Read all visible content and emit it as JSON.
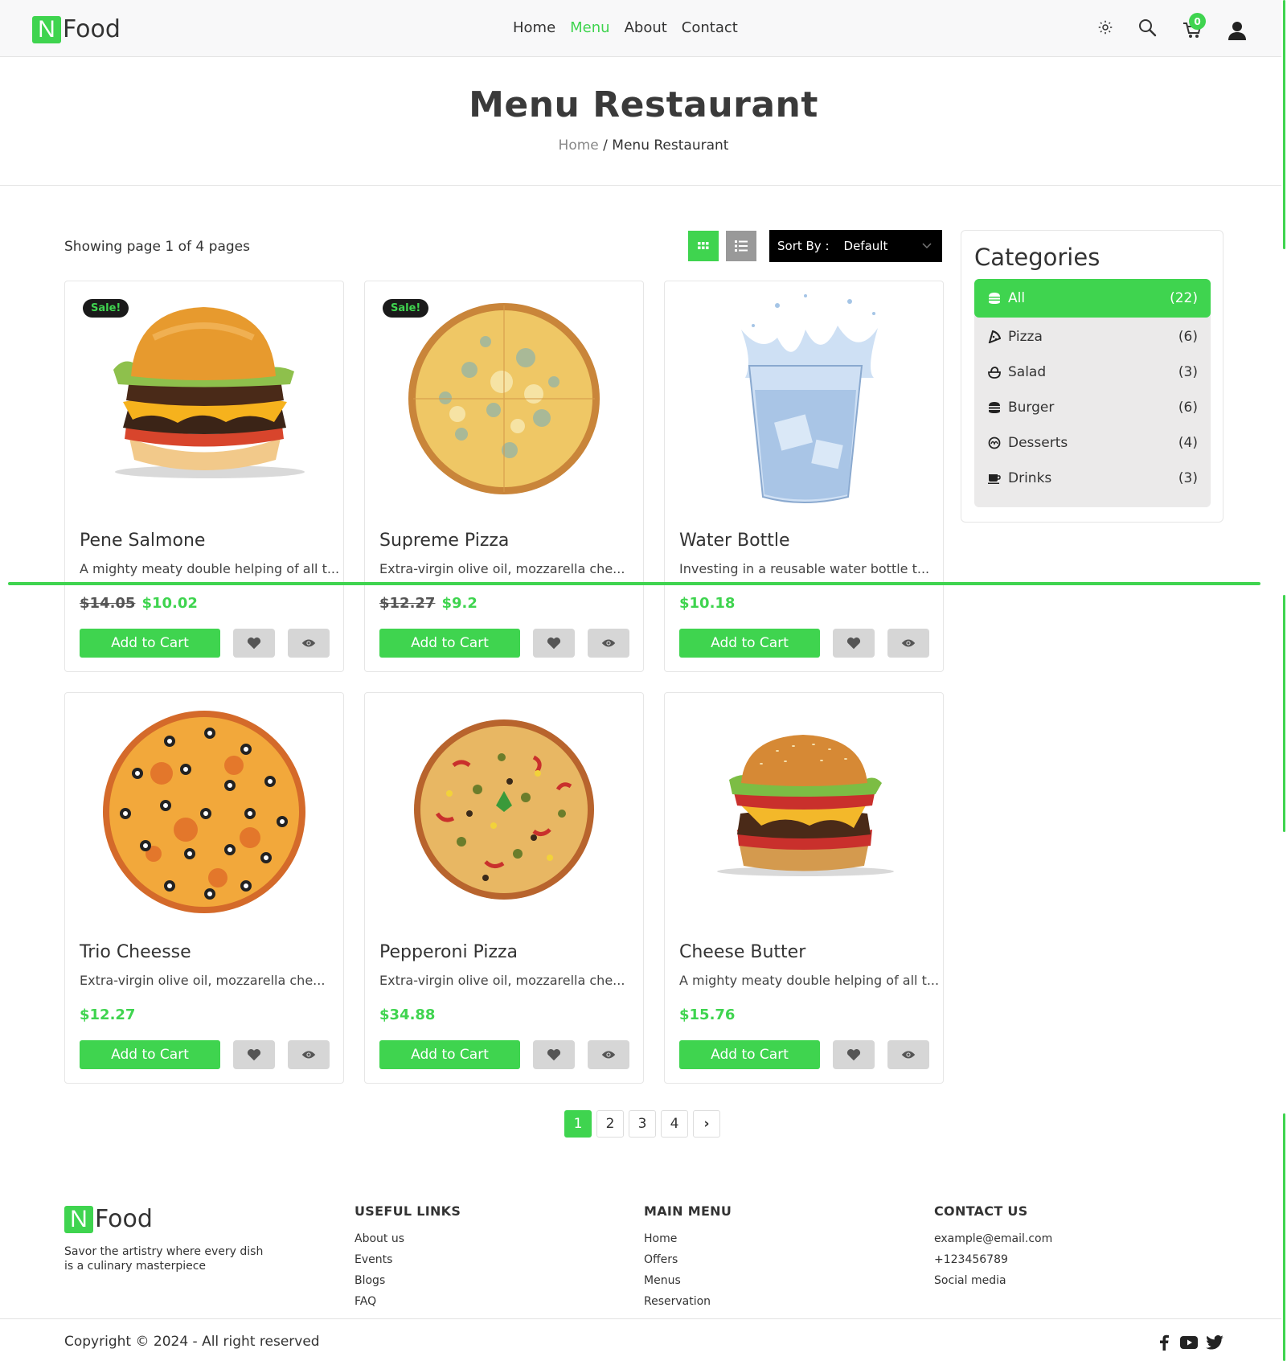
{
  "header": {
    "logo_letter": "N",
    "logo_text": "Food",
    "nav": [
      "Home",
      "Menu",
      "About",
      "Contact"
    ],
    "active_nav": "Menu",
    "cart_count": "0",
    "icons": [
      "sun-icon",
      "search-icon",
      "cart-icon",
      "user-icon"
    ]
  },
  "page": {
    "title": "Menu Restaurant",
    "breadcrumb_home": "Home",
    "breadcrumb_sep": " / ",
    "breadcrumb_current": "Menu Restaurant"
  },
  "toolbar": {
    "showing": "Showing page 1 of 4 pages",
    "sort_label": "Sort By :",
    "sort_value": "Default"
  },
  "products": [
    {
      "name": "Pene Salmone",
      "desc": "A mighty meaty double helping of all t...",
      "old_price": "$14.05",
      "price": "$10.02",
      "sale": "Sale!",
      "image": "burger"
    },
    {
      "name": "Supreme Pizza",
      "desc": "Extra-virgin olive oil, mozzarella che...",
      "old_price": "$12.27",
      "price": "$9.2",
      "sale": "Sale!",
      "image": "pizza-cheese"
    },
    {
      "name": "Water Bottle",
      "desc": "Investing in a reusable water bottle t...",
      "old_price": "",
      "price": "$10.18",
      "sale": "",
      "image": "water-glass"
    },
    {
      "name": "Trio Cheesse",
      "desc": "Extra-virgin olive oil, mozzarella che...",
      "old_price": "",
      "price": "$12.27",
      "sale": "",
      "image": "pizza-olive"
    },
    {
      "name": "Pepperoni Pizza",
      "desc": "Extra-virgin olive oil, mozzarella che...",
      "old_price": "",
      "price": "$34.88",
      "sale": "",
      "image": "pizza-pepperoni"
    },
    {
      "name": "Cheese Butter",
      "desc": "A mighty meaty double helping of all t...",
      "old_price": "",
      "price": "$15.76",
      "sale": "",
      "image": "burger-classic"
    }
  ],
  "card_buttons": {
    "add": "Add to Cart"
  },
  "categories": {
    "title": "Categories",
    "items": [
      {
        "label": "All",
        "count": "(22)",
        "icon": "burger-icon"
      },
      {
        "label": "Pizza",
        "count": "(6)",
        "icon": "pizza-icon"
      },
      {
        "label": "Salad",
        "count": "(3)",
        "icon": "salad-icon"
      },
      {
        "label": "Burger",
        "count": "(6)",
        "icon": "burger-icon"
      },
      {
        "label": "Desserts",
        "count": "(4)",
        "icon": "dessert-icon"
      },
      {
        "label": "Drinks",
        "count": "(3)",
        "icon": "mug-icon"
      }
    ],
    "active": "All"
  },
  "pagination": {
    "pages": [
      "1",
      "2",
      "3",
      "4"
    ],
    "current": "1",
    "next": "›"
  },
  "footer": {
    "tagline": "Savor the artistry where every dish is a culinary masterpiece",
    "useful_links": {
      "title": "USEFUL LINKS",
      "items": [
        "About us",
        "Events",
        "Blogs",
        "FAQ"
      ]
    },
    "main_menu": {
      "title": "MAIN MENU",
      "items": [
        "Home",
        "Offers",
        "Menus",
        "Reservation"
      ]
    },
    "contact": {
      "title": "CONTACT US",
      "items": [
        "example@email.com",
        "+123456789",
        "Social media"
      ]
    },
    "copyright": "Copyright © 2024 - All right reserved",
    "social": [
      "facebook-icon",
      "youtube-icon",
      "twitter-icon"
    ]
  },
  "colors": {
    "accent": "#3fd44f",
    "dark": "#1a1a1a",
    "muted": "#d6d6d6"
  }
}
